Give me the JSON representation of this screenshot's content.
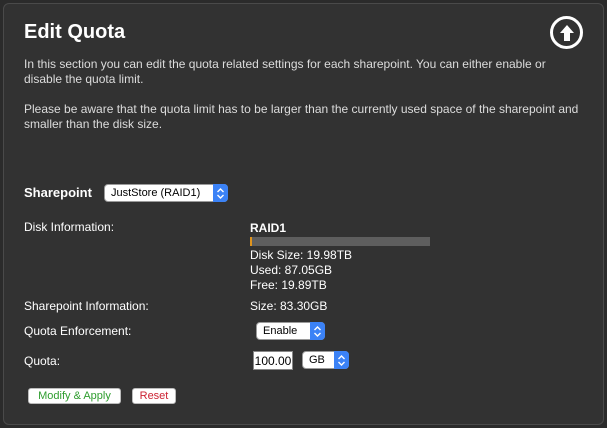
{
  "panel": {
    "title": "Edit Quota",
    "description_1": "In this section you can edit the quota related settings for each sharepoint. You can either enable or disable the quota limit.",
    "description_2": "Please be aware that the quota limit has to be larger than the currently used space of the sharepoint and smaller than the disk size."
  },
  "sharepoint": {
    "label": "Sharepoint",
    "selected": "JustStore (RAID1)"
  },
  "disk": {
    "label": "Disk Information:",
    "name": "RAID1",
    "usage_fraction": 0.0044,
    "bar_color": "#e0941c",
    "disk_size": "Disk Size: 19.98TB",
    "used": "Used: 87.05GB",
    "free": "Free: 19.89TB"
  },
  "sharepoint_info": {
    "label": "Sharepoint Information:",
    "size": "Size: 83.30GB"
  },
  "enforcement": {
    "label": "Quota Enforcement:",
    "selected": "Enable"
  },
  "quota": {
    "label": "Quota:",
    "value": "100.00",
    "unit": "GB"
  },
  "buttons": {
    "apply": "Modify & Apply",
    "reset": "Reset"
  },
  "icons": {
    "up": "arrow-up-circle-icon",
    "stepper": "select-stepper-icon"
  },
  "colors": {
    "select_accent": "#3b82f6",
    "apply_text": "#2e9d2e",
    "reset_text": "#cc2233"
  }
}
